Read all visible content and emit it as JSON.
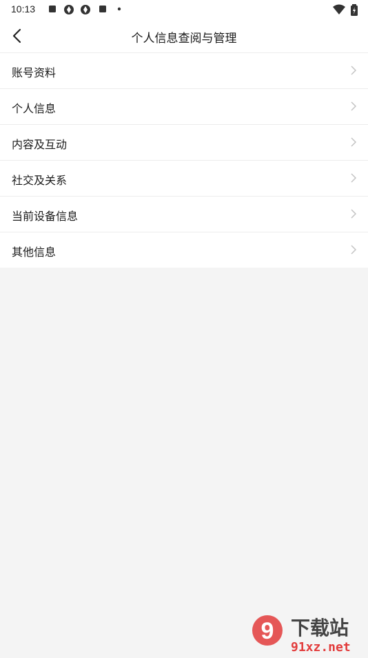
{
  "status_bar": {
    "time": "10:13",
    "icons": [
      "square-icon",
      "aperture-icon",
      "aperture-icon",
      "square-icon",
      "dot-icon",
      "wifi-icon",
      "battery-icon"
    ]
  },
  "header": {
    "title": "个人信息查阅与管理",
    "back_icon": "chevron-left-icon"
  },
  "menu": {
    "items": [
      {
        "label": "账号资料"
      },
      {
        "label": "个人信息"
      },
      {
        "label": "内容及互动"
      },
      {
        "label": "社交及关系"
      },
      {
        "label": "当前设备信息"
      },
      {
        "label": "其他信息"
      }
    ]
  },
  "watermark": {
    "logo_text": "9",
    "title": "下载站",
    "domain": "91xz.net"
  },
  "colors": {
    "background": "#f4f4f4",
    "surface": "#ffffff",
    "divider": "#ececec",
    "chevron": "#c4c4c4",
    "watermark_red": "#e23b3b"
  }
}
